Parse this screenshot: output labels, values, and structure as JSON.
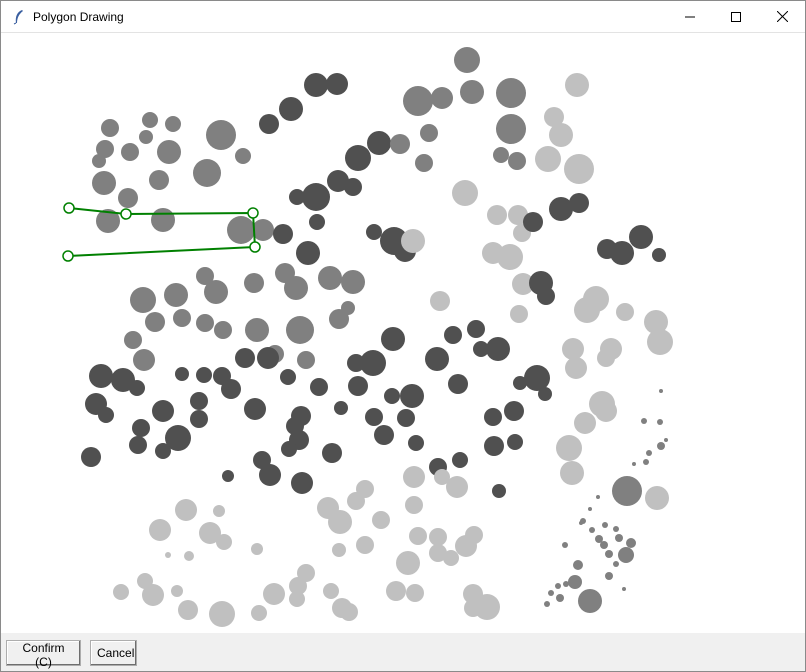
{
  "window": {
    "title": "Polygon Drawing",
    "icon": "feather-icon"
  },
  "colors": {
    "polygon_stroke": "#008000",
    "vertex_fill": "#ffffff",
    "circle_dark": "#505050",
    "circle_mid": "#808080",
    "circle_light": "#c0c0c0"
  },
  "buttons": {
    "confirm_label": "Confirm (C)",
    "cancel_label": "Cancel"
  },
  "polygon": {
    "closed": false,
    "vertex_count": 5
  }
}
